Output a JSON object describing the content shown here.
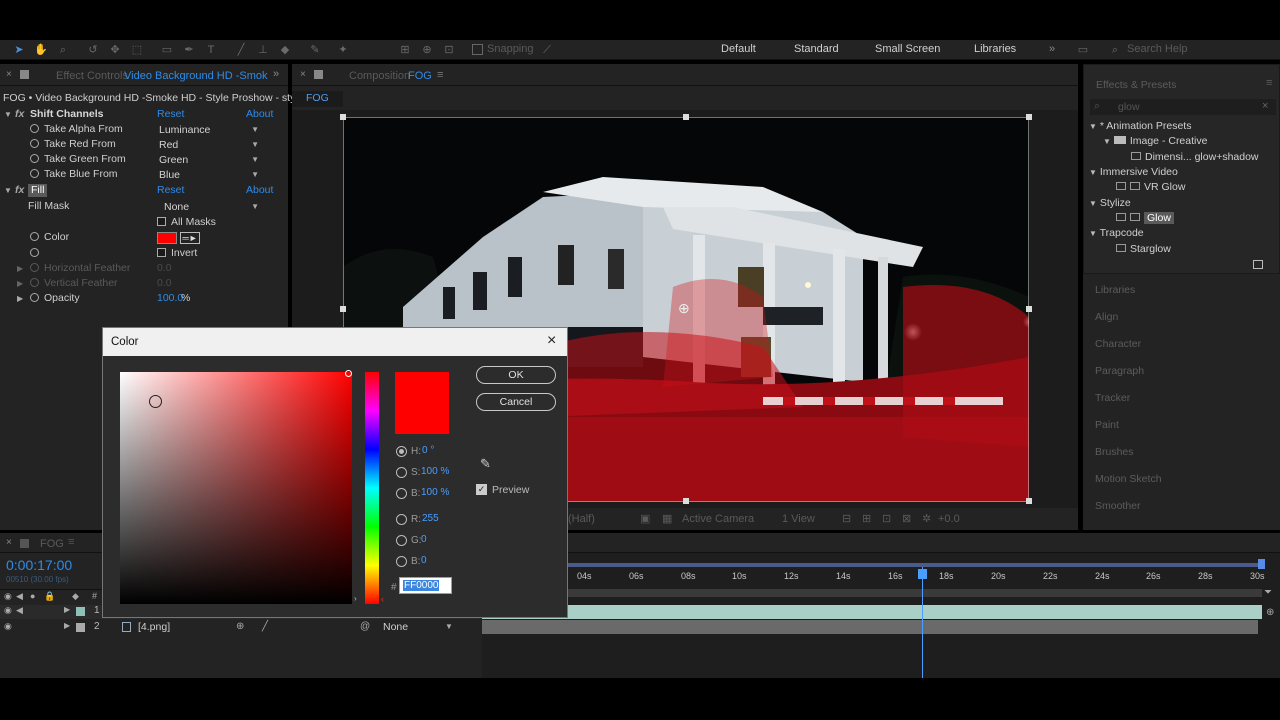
{
  "toolbar": {
    "snapping": "Snapping"
  },
  "workspaces": [
    "Default",
    "Standard",
    "Small Screen",
    "Libraries"
  ],
  "search_help": "Search Help",
  "effect_controls": {
    "tab_prefix": "Effect Controls",
    "tab_layer": "Video Background HD -Smok",
    "header": "FOG • Video Background HD -Smoke HD - Style Proshow - style",
    "reset": "Reset",
    "about": "About",
    "shift_channels": {
      "name": "Shift Channels",
      "props": [
        {
          "label": "Take Alpha From",
          "value": "Luminance"
        },
        {
          "label": "Take Red From",
          "value": "Red"
        },
        {
          "label": "Take Green From",
          "value": "Green"
        },
        {
          "label": "Take Blue From",
          "value": "Blue"
        }
      ]
    },
    "fill": {
      "name": "Fill",
      "fill_mask_label": "Fill Mask",
      "fill_mask_value": "None",
      "all_masks": "All Masks",
      "color_label": "Color",
      "invert": "Invert",
      "horizontal_feather": "Horizontal Feather",
      "horizontal_feather_value": "0.0",
      "vertical_feather": "Vertical Feather",
      "vertical_feather_value": "0.0",
      "opacity_label": "Opacity",
      "opacity_value": "100.0",
      "opacity_unit": "%"
    }
  },
  "composition": {
    "tab_prefix": "Composition",
    "tab_name": "FOG",
    "breadcrumb": "FOG",
    "footer_view": "Active Camera",
    "footer_views": "1 View",
    "footer_exposure": "+0.0",
    "footer_res": "(Half)"
  },
  "effects_presets": {
    "title": "Effects & Presets",
    "search_value": "glow",
    "tree": [
      {
        "label": "* Animation Presets",
        "type": "group",
        "level": 0
      },
      {
        "label": "Image - Creative",
        "type": "folder",
        "level": 1
      },
      {
        "label": "Dimensi... glow+shadow",
        "type": "fx",
        "level": 2
      },
      {
        "label": "Immersive Video",
        "type": "group",
        "level": 0
      },
      {
        "label": "VR Glow",
        "type": "fx",
        "level": 1
      },
      {
        "label": "Stylize",
        "type": "group",
        "level": 0
      },
      {
        "label": "Glow",
        "type": "fx-selected",
        "level": 1
      },
      {
        "label": "Trapcode",
        "type": "group",
        "level": 0
      },
      {
        "label": "Starglow",
        "type": "fx",
        "level": 1
      }
    ],
    "panels": [
      "Libraries",
      "Align",
      "Character",
      "Paragraph",
      "Tracker",
      "Paint",
      "Brushes",
      "Motion Sketch",
      "Smoother"
    ]
  },
  "timeline": {
    "tab": "FOG",
    "timecode": "0:00:17:00",
    "frames": "00510 (30.00 fps)",
    "ruler": [
      "04s",
      "06s",
      "08s",
      "10s",
      "12s",
      "14s",
      "16s",
      "18s",
      "20s",
      "22s",
      "24s",
      "26s",
      "28s",
      "30s"
    ],
    "layers": [
      {
        "num": "1",
        "name": ""
      },
      {
        "num": "2",
        "name": "[4.png]",
        "mode": "None"
      }
    ]
  },
  "color_dialog": {
    "title": "Color",
    "ok": "OK",
    "cancel": "Cancel",
    "preview": "Preview",
    "fields": [
      {
        "label": "H:",
        "value": "0 °"
      },
      {
        "label": "S:",
        "value": "100 %"
      },
      {
        "label": "B:",
        "value": "100 %"
      },
      {
        "label": "R:",
        "value": "255"
      },
      {
        "label": "G:",
        "value": "0"
      },
      {
        "label": "B:",
        "value": "0"
      }
    ],
    "hash": "#",
    "hex": "FF0000",
    "swatch_color": "#ff0000"
  },
  "colors": {
    "accent_blue": "#2d8ceb",
    "fill_red": "#ff0000"
  }
}
